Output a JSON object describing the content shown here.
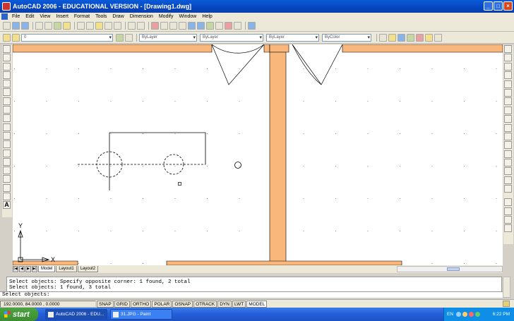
{
  "window": {
    "title": "AutoCAD 2006 - EDUCATIONAL VERSION - [Drawing1.dwg]",
    "buttons": [
      "_",
      "□",
      "×"
    ]
  },
  "menubar": {
    "items": [
      "File",
      "Edit",
      "View",
      "Insert",
      "Format",
      "Tools",
      "Draw",
      "Dimension",
      "Modify",
      "Window",
      "Help"
    ]
  },
  "properties_toolbar": {
    "layer_value": "0",
    "color_value": "ByLayer",
    "linetype_value": "ByLayer",
    "lineweight_value": "ByLayer",
    "plotstyle_value": "ByColor"
  },
  "tabs": {
    "items": [
      "Model",
      "Layout1",
      "Layout2"
    ],
    "active": "Model"
  },
  "ucs": {
    "x_label": "X",
    "y_label": "Y"
  },
  "command": {
    "history": [
      "Select objects: Specify opposite corner: 1 found, 2 total",
      "Select objects: 1 found, 3 total"
    ],
    "prompt": "Select objects:"
  },
  "statusbar": {
    "coordinates": "192.0000, 84.0000 , 0.0000",
    "toggles": [
      "SNAP",
      "GRID",
      "ORTHO",
      "POLAR",
      "OSNAP",
      "OTRACK",
      "DYN",
      "LWT",
      "MODEL"
    ]
  },
  "taskbar": {
    "start_label": "start",
    "tasks": [
      "AutoCAD 2006 - EDU...",
      "31.JPG - Paint"
    ],
    "language": "EN",
    "clock": "6:22 PM"
  },
  "colors": {
    "wall": "#f9b77c",
    "titlebar": "#0646c0"
  }
}
